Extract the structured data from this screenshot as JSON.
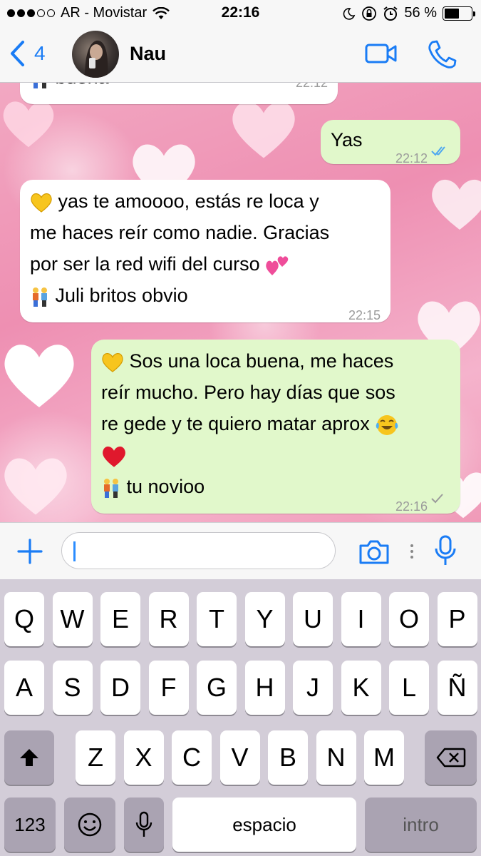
{
  "status_bar": {
    "carrier": "AR - Movistar",
    "time": "22:16",
    "battery": "56 %",
    "battery_level": 0.56
  },
  "nav": {
    "back_count": "4",
    "contact_name": "Nau"
  },
  "messages": [
    {
      "direction": "incoming",
      "text": "buena",
      "time": "22:12"
    },
    {
      "direction": "outgoing",
      "text": "Yas",
      "time": "22:12",
      "status": "read"
    },
    {
      "direction": "incoming",
      "lines": [
        "yas te amoooo, estás re loca y",
        "me haces reír como nadie. Gracias",
        "por ser la red wifi del curso",
        "Juli britos obvio"
      ],
      "time": "22:15"
    },
    {
      "direction": "outgoing",
      "lines": [
        "Sos una loca buena, me haces",
        "reír mucho. Pero hay días que sos",
        "re gede y te quiero matar aprox",
        "",
        "tu novioo"
      ],
      "time": "22:16",
      "status": "delivered"
    }
  ],
  "keyboard": {
    "row1": [
      "Q",
      "W",
      "E",
      "R",
      "T",
      "Y",
      "U",
      "I",
      "O",
      "P"
    ],
    "row2": [
      "A",
      "S",
      "D",
      "F",
      "G",
      "H",
      "J",
      "K",
      "L",
      "Ñ"
    ],
    "row3": [
      "Z",
      "X",
      "C",
      "V",
      "B",
      "N",
      "M"
    ],
    "numbers_key": "123",
    "space_key": "espacio",
    "return_key": "intro"
  },
  "colors": {
    "accent": "#1a7cf5",
    "outgoing_bubble": "#e1f8cb",
    "incoming_bubble": "#ffffff",
    "read_ticks": "#4fa8f0"
  }
}
